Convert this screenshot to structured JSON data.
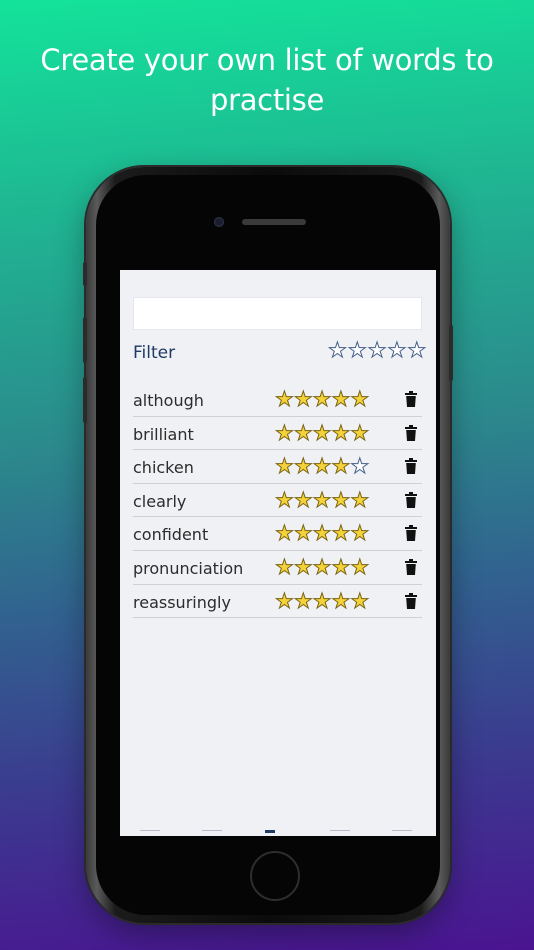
{
  "headline": "Create your own list of words to practise",
  "filter": {
    "label": "Filter",
    "rating": 0
  },
  "words": [
    {
      "word": "although",
      "rating": 5
    },
    {
      "word": "brilliant",
      "rating": 5
    },
    {
      "word": "chicken",
      "rating": 4
    },
    {
      "word": "clearly",
      "rating": 5
    },
    {
      "word": "confident",
      "rating": 5
    },
    {
      "word": "pronunciation",
      "rating": 5
    },
    {
      "word": "reassuringly",
      "rating": 5
    }
  ],
  "colors": {
    "star_fill": "#f4d23a",
    "star_outline": "#445f8a",
    "filter_text": "#1f3a63",
    "gradient_top": "#13e39a",
    "gradient_bottom": "#4a1490"
  },
  "icons": {
    "delete": "trash-icon",
    "star": "star-icon"
  }
}
